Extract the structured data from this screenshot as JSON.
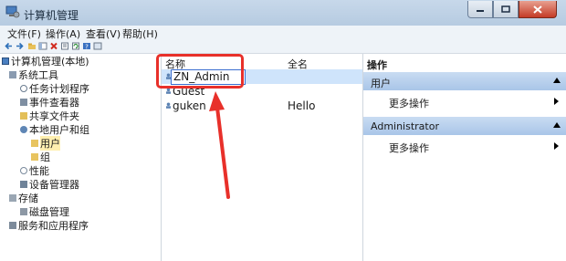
{
  "window": {
    "title": "计算机管理"
  },
  "menubar": {
    "items": [
      "文件(F)",
      "操作(A)",
      "查看(V)",
      "帮助(H)"
    ]
  },
  "tree": {
    "items": [
      {
        "label": "计算机管理(本地)",
        "level": 0,
        "icon": "computer-icon"
      },
      {
        "label": "系统工具",
        "level": 1,
        "icon": "tools-icon"
      },
      {
        "label": "任务计划程序",
        "level": 2,
        "icon": "clock-icon"
      },
      {
        "label": "事件查看器",
        "level": 2,
        "icon": "event-viewer-icon"
      },
      {
        "label": "共享文件夹",
        "level": 2,
        "icon": "shared-folder-icon"
      },
      {
        "label": "本地用户和组",
        "level": 2,
        "icon": "users-icon"
      },
      {
        "label": "用户",
        "level": 3,
        "icon": "folder-icon",
        "selected": true
      },
      {
        "label": "组",
        "level": 3,
        "icon": "folder-icon"
      },
      {
        "label": "性能",
        "level": 2,
        "icon": "performance-icon"
      },
      {
        "label": "设备管理器",
        "level": 2,
        "icon": "device-manager-icon"
      },
      {
        "label": "存储",
        "level": 1,
        "icon": "storage-icon"
      },
      {
        "label": "磁盘管理",
        "level": 2,
        "icon": "disk-icon"
      },
      {
        "label": "服务和应用程序",
        "level": 1,
        "icon": "services-icon"
      }
    ]
  },
  "list": {
    "columns": [
      "名称",
      "全名"
    ],
    "rows": [
      {
        "name": "ZN_Admin",
        "fullname": "",
        "editing": true
      },
      {
        "name": "Guest",
        "fullname": ""
      },
      {
        "name": "guken",
        "fullname": "Hello"
      }
    ]
  },
  "actions": {
    "header": "操作",
    "sections": [
      {
        "title": "用户",
        "item": "更多操作"
      },
      {
        "title": "Administrator",
        "item": "更多操作"
      }
    ]
  },
  "colors": {
    "annotation": "#e8302a",
    "section_bg": "#b9d1ee",
    "selection": "#cfe4fb"
  }
}
